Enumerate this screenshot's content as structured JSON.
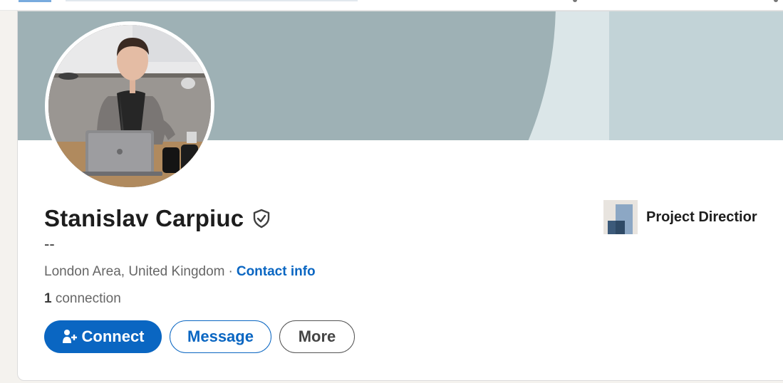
{
  "profile": {
    "name": "Stanislav Carpiuc",
    "headline": "--",
    "location": "London Area, United Kingdom",
    "separator": "·",
    "contact_label": "Contact info",
    "connection_count": "1",
    "connection_label": "connection"
  },
  "actions": {
    "connect": "Connect",
    "message": "Message",
    "more": "More"
  },
  "experience": {
    "company": "Project Directior"
  },
  "icons": {
    "verified": "verified-shield-icon",
    "connect": "add-person-icon",
    "company_logo": "company-building-logo"
  },
  "colors": {
    "accent": "#0a66c2",
    "banner_dark": "#9eb1b5",
    "banner_light": "#c2d3d7"
  }
}
